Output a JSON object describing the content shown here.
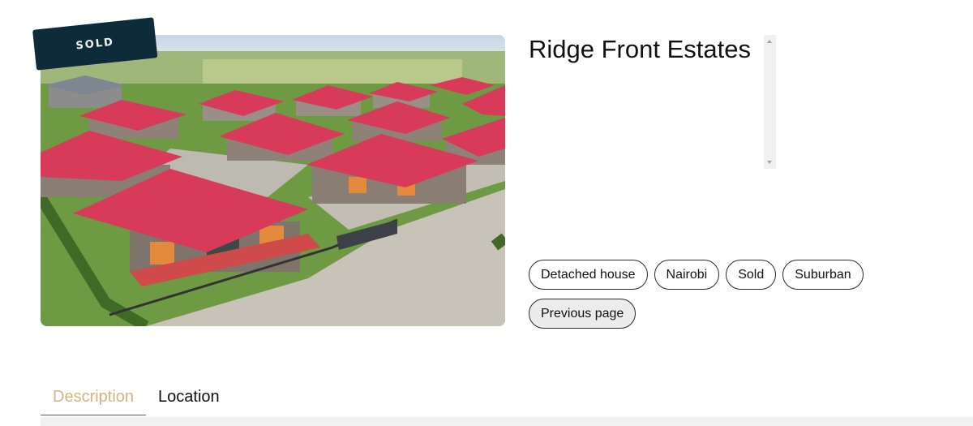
{
  "listing": {
    "title": "Ridge Front Estates",
    "status_badge": "SOLD",
    "image_icon": "estate-aerial-photo"
  },
  "tags": [
    "Detached house",
    "Nairobi",
    "Sold",
    "Suburban"
  ],
  "previous_page_label": "Previous page",
  "tabs": [
    {
      "label": "Description",
      "active": true
    },
    {
      "label": "Location",
      "active": false
    }
  ],
  "colors": {
    "accent_tab": "#d4b483",
    "badge_bg": "#0e2b3a",
    "roof": "#d83a5a"
  }
}
